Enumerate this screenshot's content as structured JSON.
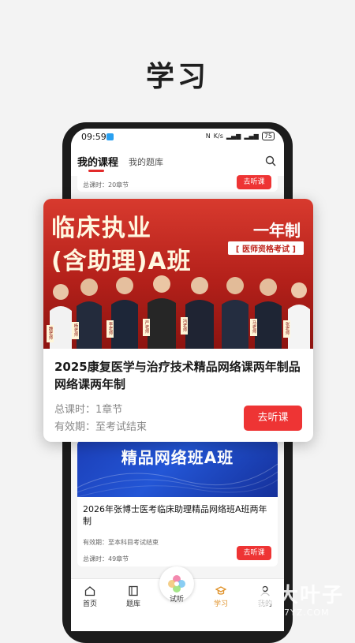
{
  "headline": "学习",
  "status": {
    "time": "09:59",
    "net_speed": "K/s",
    "battery": "75"
  },
  "tabs": {
    "my_courses": "我的课程",
    "my_questions": "我的题库"
  },
  "prev_card": {
    "hours": "总课时：20章节",
    "button": "去听课"
  },
  "featured": {
    "banner_line1": "临床执业",
    "banner_line2": "(含助理)A班",
    "banner_duration": "一年制",
    "banner_exam": "[ 医师资格考试 ]",
    "teachers": [
      "魏老师",
      "杨老师",
      "李老师",
      "严老师",
      "冯老师",
      "马老师",
      "张老师"
    ],
    "title": "2025康复医学与治疗技术精品网络课两年制品网络课两年制",
    "hours": "总课时：1章节",
    "validity": "有效期：至考试结束",
    "button": "去听课"
  },
  "card2": {
    "banner_text": "精品网络班A班",
    "title": "2026年张博士医考临床助理精品网络班A班两年制",
    "validity": "有效期：至本科目考试结束",
    "hours": "总课时：49章节",
    "button": "去听课"
  },
  "nav": {
    "home": "首页",
    "questions": "题库",
    "trial": "试听",
    "study": "学习",
    "mine": "我的"
  },
  "watermark": {
    "text": "大叶子",
    "url": "7YZ.COM"
  },
  "colors": {
    "accent_red": "#ee3434",
    "nav_active": "#e0932b"
  }
}
